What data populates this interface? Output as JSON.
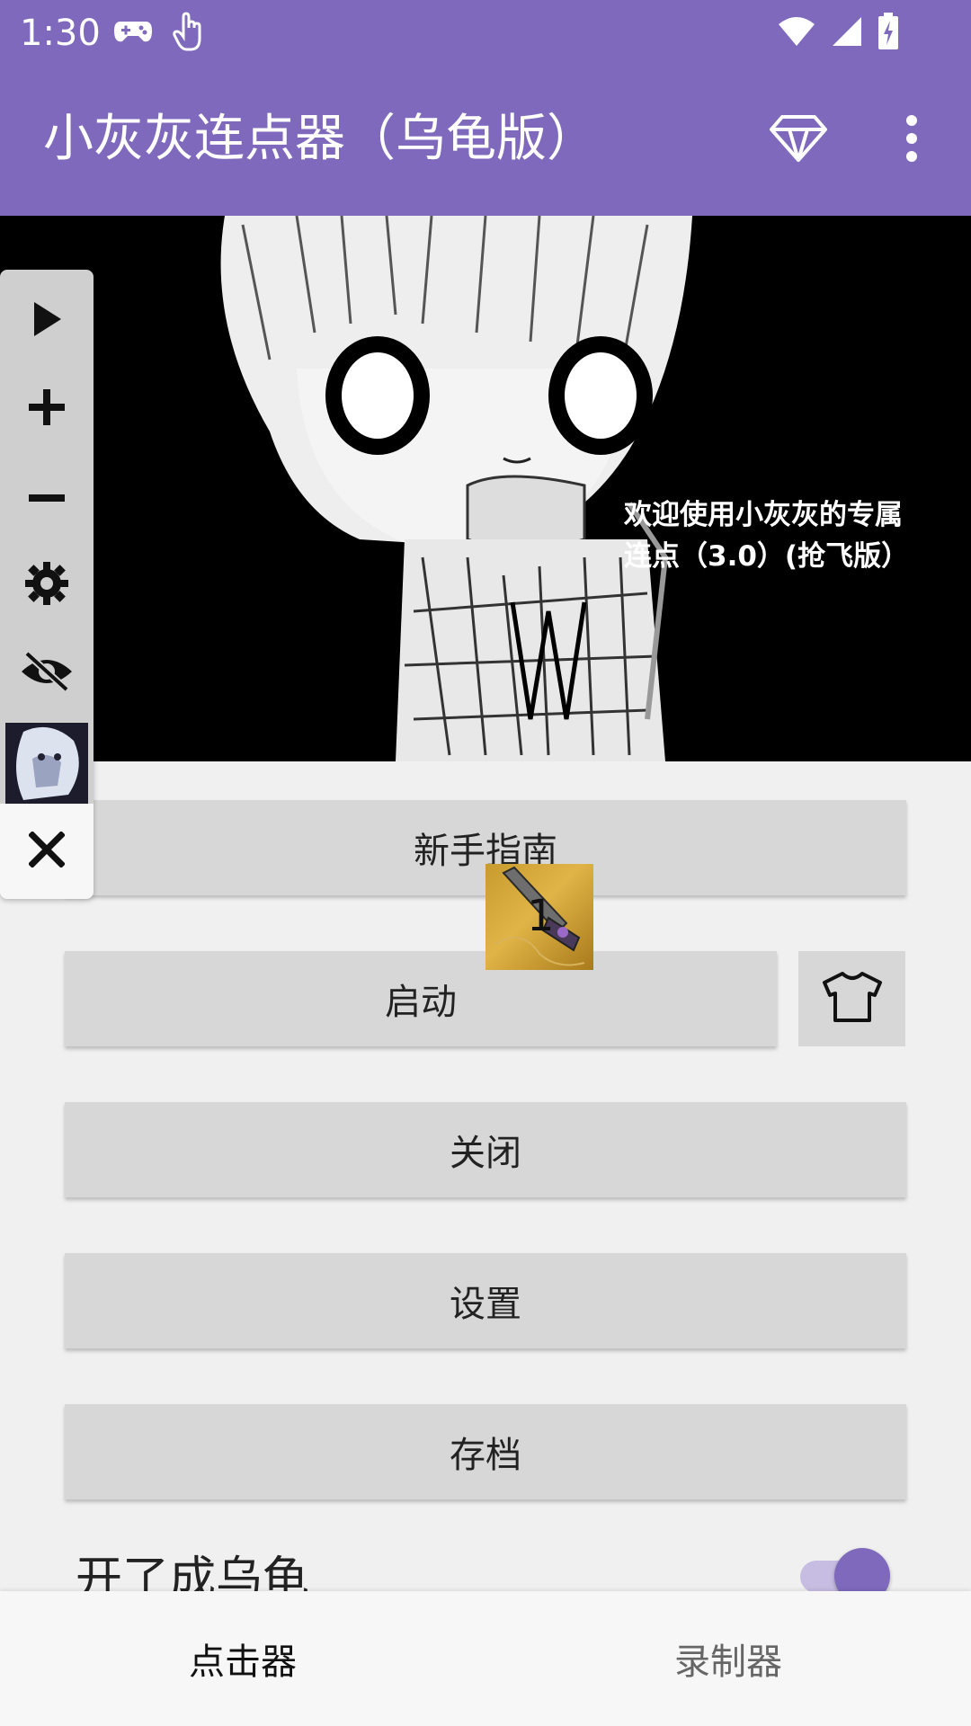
{
  "status_bar": {
    "time": "1:30",
    "left_icons": [
      "gamepad-icon",
      "touch-icon"
    ],
    "right_icons": [
      "wifi-icon",
      "signal-icon",
      "battery-icon"
    ]
  },
  "app_bar": {
    "title": "小灰灰连点器（乌龟版）",
    "actions": [
      "diamond-icon",
      "more-vert-icon"
    ]
  },
  "banner": {
    "caption_line1": "欢迎使用小灰灰的专属",
    "caption_line2": "连点（3.0）(抢飞版）"
  },
  "float_toolbar": {
    "items": [
      "play-icon",
      "plus-icon",
      "minus-icon",
      "gear-icon",
      "eye-off-icon",
      "close-icon"
    ]
  },
  "weapon_overlay": {
    "count": "1"
  },
  "buttons": {
    "guide": "新手指南",
    "start": "启动",
    "close": "关闭",
    "settings": "设置",
    "save": "存档"
  },
  "toggle": {
    "label": "开了成乌龟",
    "on": true,
    "accent": "#7e69bd"
  },
  "bottom_nav": {
    "tabs": [
      {
        "label": "点击器",
        "active": true
      },
      {
        "label": "录制器",
        "active": false
      }
    ]
  },
  "colors": {
    "primary": "#7e69bd",
    "button_bg": "#d7d7d7",
    "background": "#f0f0f0"
  }
}
